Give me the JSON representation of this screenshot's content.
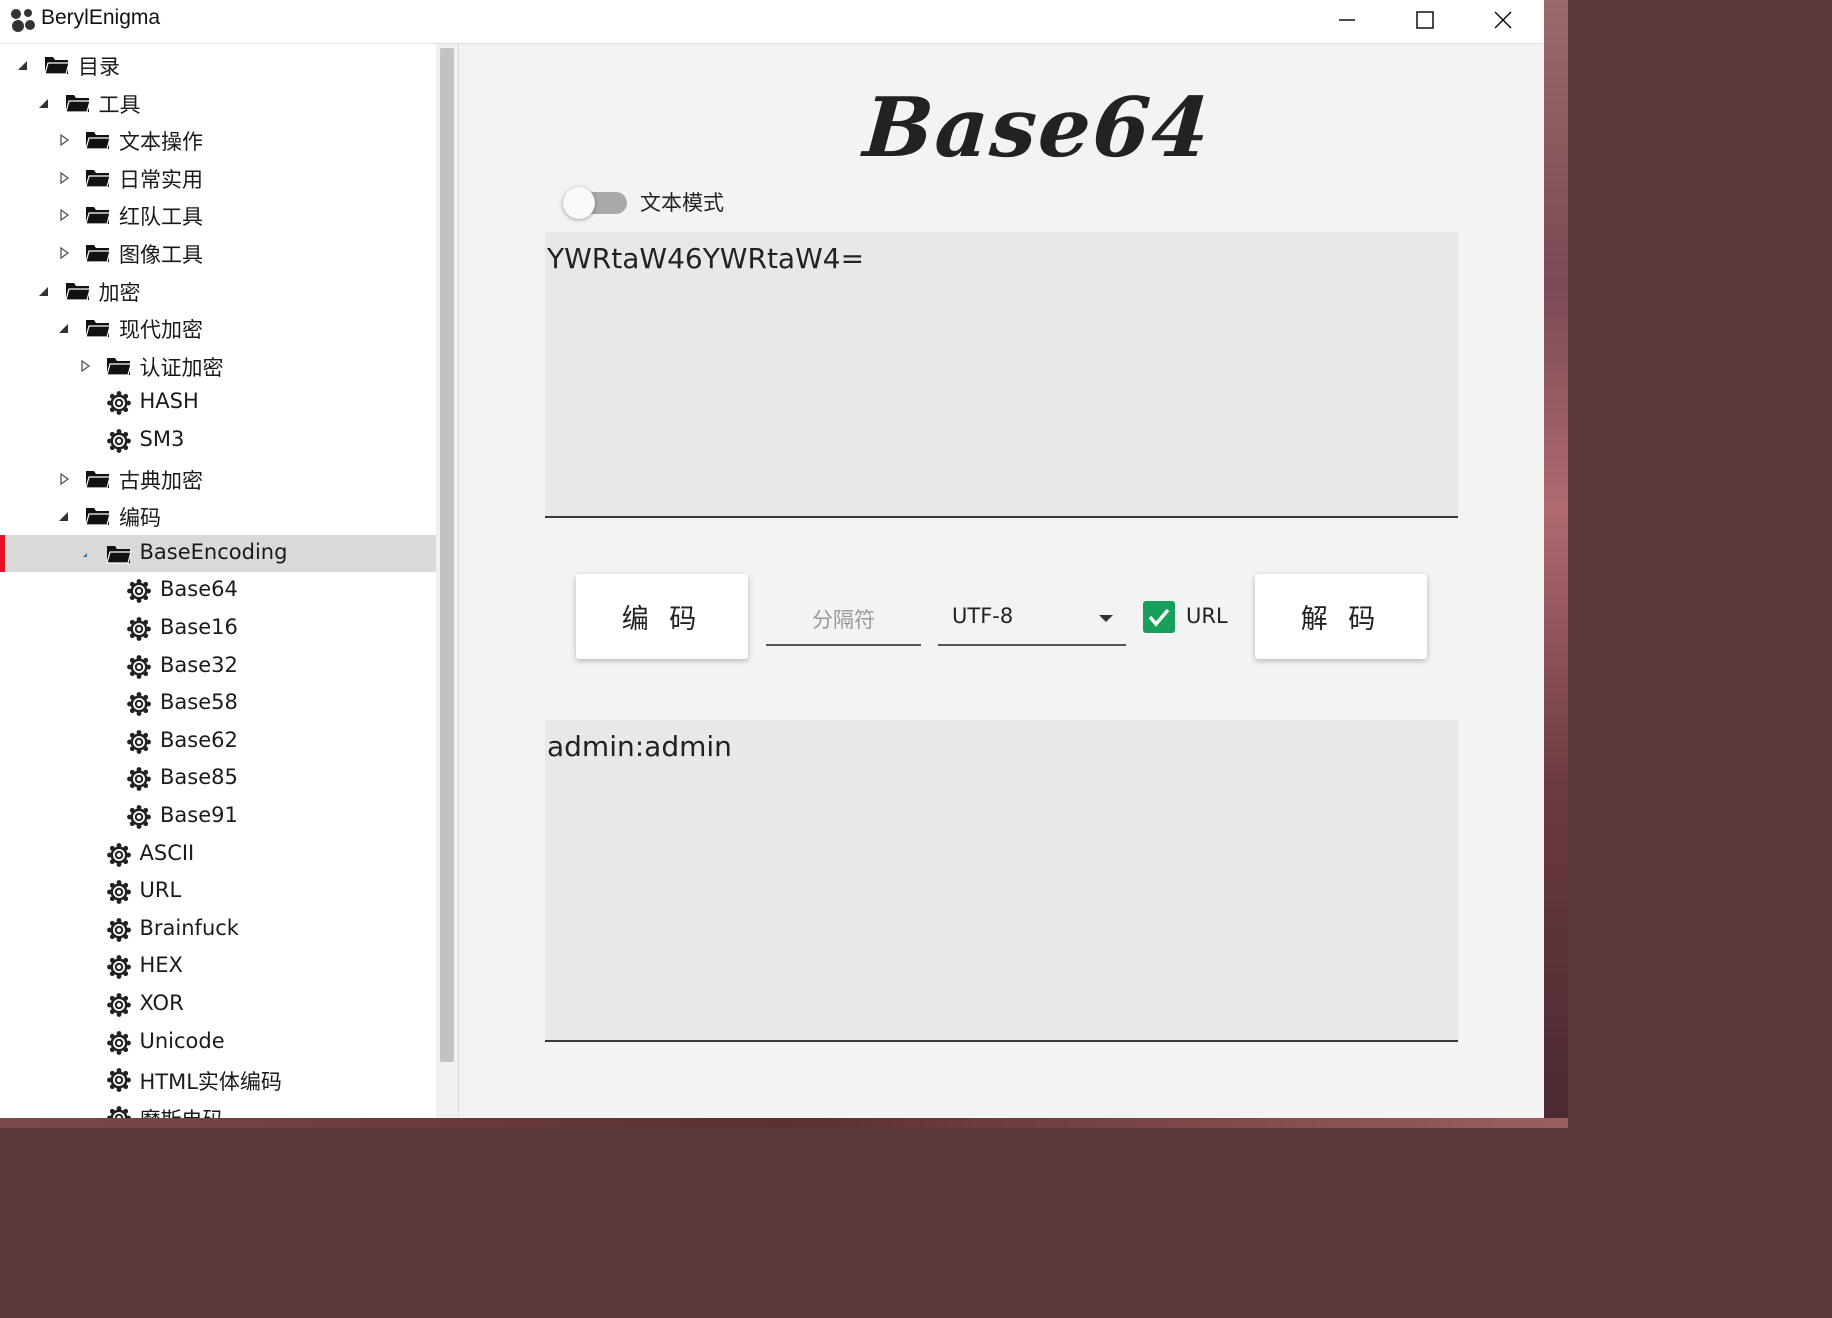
{
  "window": {
    "title": "BerylEnigma",
    "controls": [
      "minimize",
      "maximize",
      "close"
    ]
  },
  "tree": {
    "nodes": [
      {
        "label": "目录",
        "icon": "folder-icon",
        "expander": "expanded",
        "level": 0
      },
      {
        "label": "工具",
        "icon": "folder-icon",
        "expander": "expanded",
        "level": 1
      },
      {
        "label": "文本操作",
        "icon": "folder-icon",
        "expander": "collapsed",
        "level": 2
      },
      {
        "label": "日常实用",
        "icon": "folder-icon",
        "expander": "collapsed",
        "level": 2
      },
      {
        "label": "红队工具",
        "icon": "folder-icon",
        "expander": "collapsed",
        "level": 2
      },
      {
        "label": "图像工具",
        "icon": "folder-icon",
        "expander": "collapsed",
        "level": 2
      },
      {
        "label": "加密",
        "icon": "folder-icon",
        "expander": "expanded",
        "level": 1
      },
      {
        "label": "现代加密",
        "icon": "folder-icon",
        "expander": "expanded",
        "level": 2
      },
      {
        "label": "认证加密",
        "icon": "folder-icon",
        "expander": "collapsed",
        "level": 3
      },
      {
        "label": "HASH",
        "icon": "gear-icon",
        "expander": "none",
        "level": 3
      },
      {
        "label": "SM3",
        "icon": "gear-icon",
        "expander": "none",
        "level": 3
      },
      {
        "label": "古典加密",
        "icon": "folder-icon",
        "expander": "collapsed",
        "level": 2
      },
      {
        "label": "编码",
        "icon": "folder-icon",
        "expander": "expanded",
        "level": 2
      },
      {
        "label": "BaseEncoding",
        "icon": "folder-icon",
        "expander": "expanded-small",
        "level": 3,
        "selected": true
      },
      {
        "label": "Base64",
        "icon": "gear-icon",
        "expander": "none",
        "level": 4
      },
      {
        "label": "Base16",
        "icon": "gear-icon",
        "expander": "none",
        "level": 4
      },
      {
        "label": "Base32",
        "icon": "gear-icon",
        "expander": "none",
        "level": 4
      },
      {
        "label": "Base58",
        "icon": "gear-icon",
        "expander": "none",
        "level": 4
      },
      {
        "label": "Base62",
        "icon": "gear-icon",
        "expander": "none",
        "level": 4
      },
      {
        "label": "Base85",
        "icon": "gear-icon",
        "expander": "none",
        "level": 4
      },
      {
        "label": "Base91",
        "icon": "gear-icon",
        "expander": "none",
        "level": 4
      },
      {
        "label": "ASCII",
        "icon": "gear-icon",
        "expander": "none",
        "level": 3
      },
      {
        "label": "URL",
        "icon": "gear-icon",
        "expander": "none",
        "level": 3
      },
      {
        "label": "Brainfuck",
        "icon": "gear-icon",
        "expander": "none",
        "level": 3
      },
      {
        "label": "HEX",
        "icon": "gear-icon",
        "expander": "none",
        "level": 3
      },
      {
        "label": "XOR",
        "icon": "gear-icon",
        "expander": "none",
        "level": 3
      },
      {
        "label": "Unicode",
        "icon": "gear-icon",
        "expander": "none",
        "level": 3
      },
      {
        "label": "HTML实体编码",
        "icon": "gear-icon",
        "expander": "none",
        "level": 3
      },
      {
        "label": "摩斯电码",
        "icon": "gear-icon",
        "expander": "none",
        "level": 3
      }
    ]
  },
  "main": {
    "title": "Base64",
    "text_mode": {
      "label": "文本模式",
      "on": false
    },
    "input_text": "YWRtaW46YWRtaW4=",
    "encode_label": "编 码",
    "decode_label": "解 码",
    "separator_placeholder": "分隔符",
    "charset": "UTF-8",
    "url_option": {
      "label": "URL",
      "checked": true
    },
    "output_text": "admin:admin"
  },
  "colors": {
    "accent_check": "#16a05a",
    "selection_marker": "#e81123",
    "selected_row": "#d9d9d9"
  }
}
